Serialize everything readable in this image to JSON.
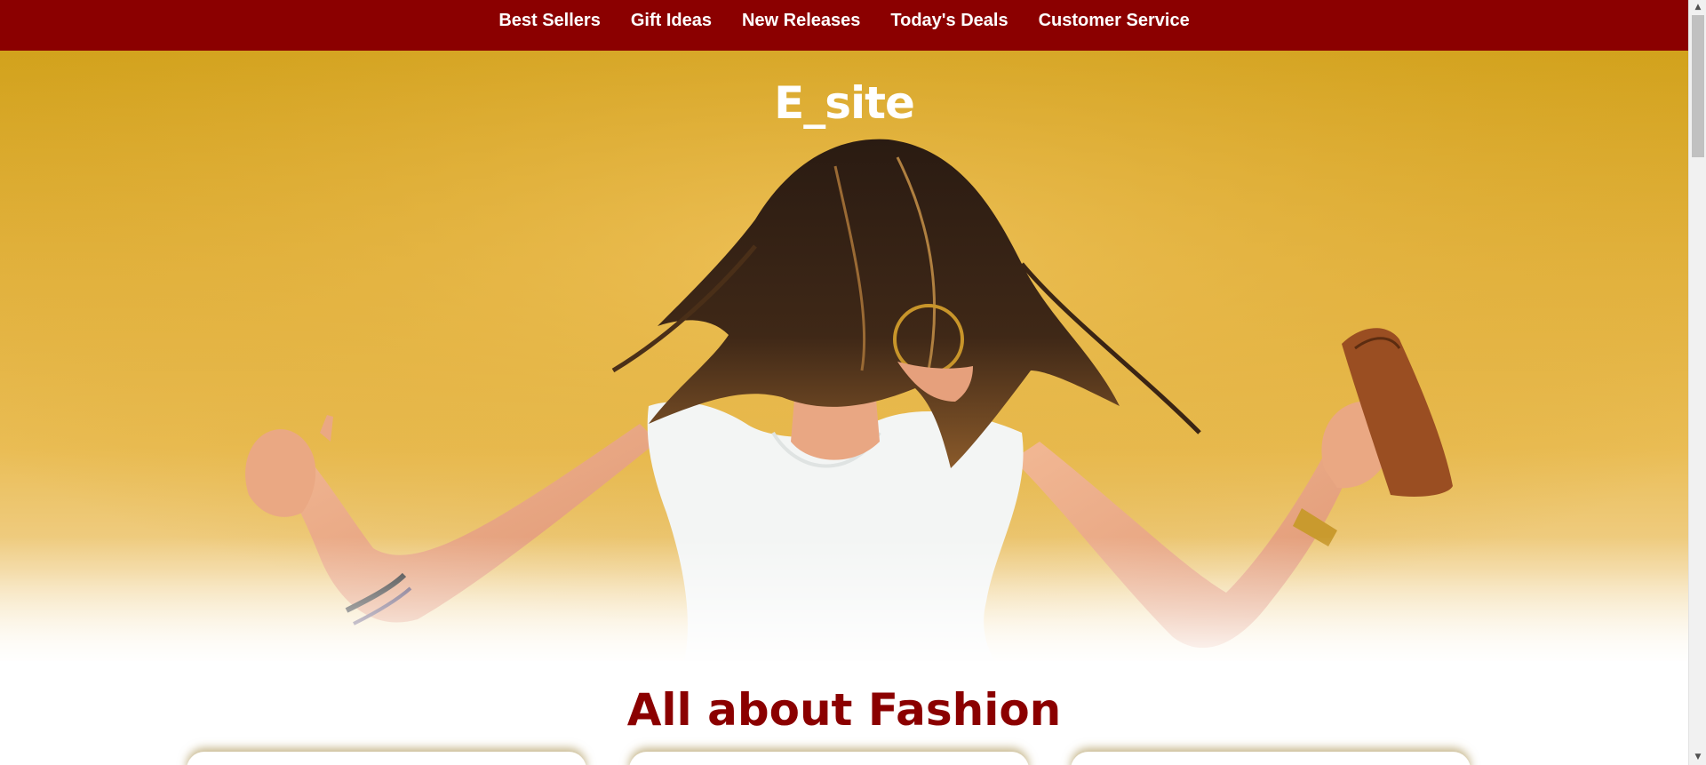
{
  "nav": {
    "items": [
      {
        "label": "Best Sellers"
      },
      {
        "label": "Gift Ideas"
      },
      {
        "label": "New Releases"
      },
      {
        "label": "Today's Deals"
      },
      {
        "label": "Customer Service"
      }
    ]
  },
  "hero": {
    "title": "E_site",
    "image": "woman-dancing-yellow-wall-photo"
  },
  "section": {
    "title": "All about Fashion",
    "cards": 3
  },
  "colors": {
    "brand": "#8b0000",
    "hero_bg": "#e2b23e",
    "text_light": "#ffffff"
  },
  "icons": {
    "scroll_up": "scroll-up-arrow-icon",
    "scroll_down": "scroll-down-arrow-icon"
  }
}
